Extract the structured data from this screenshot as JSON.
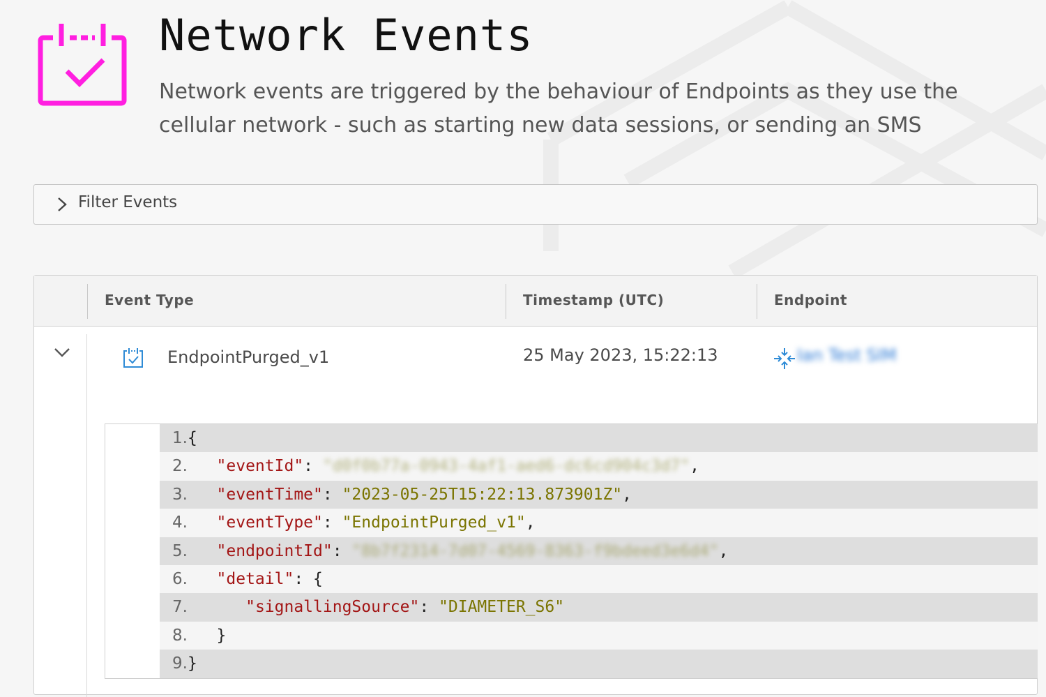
{
  "page": {
    "title": "Network Events",
    "description": "Network events are triggered by the behaviour of Endpoints as they use the cellular network - such as starting new data sessions, or sending an SMS",
    "icon": "calendar-check-icon",
    "accent_color": "#ff1fe0"
  },
  "filter": {
    "label": "Filter Events",
    "icon": "chevron-right-icon"
  },
  "table": {
    "columns": [
      "Event Type",
      "Timestamp (UTC)",
      "Endpoint"
    ],
    "rows": [
      {
        "event_type": "EndpointPurged_v1",
        "timestamp": "25 May 2023, 15:22:13",
        "endpoint": "Ian Test SIM",
        "event_icon": "calendar-check-icon",
        "endpoint_icon": "compress-arrows-icon",
        "expanded": true
      }
    ]
  },
  "code": {
    "lines": [
      {
        "n": "1.",
        "indent": "",
        "key": "",
        "sep": "",
        "value": "",
        "value_class": "",
        "tail": "{"
      },
      {
        "n": "2.",
        "indent": "   ",
        "key": "\"eventId\"",
        "sep": ": ",
        "value": "\"d0f0b77a-0943-4af1-aed6-dc6cd904c3d7\"",
        "value_class": "redacted",
        "tail": ","
      },
      {
        "n": "3.",
        "indent": "   ",
        "key": "\"eventTime\"",
        "sep": ": ",
        "value": "\"2023-05-25T15:22:13.873901Z\"",
        "value_class": "str",
        "tail": ","
      },
      {
        "n": "4.",
        "indent": "   ",
        "key": "\"eventType\"",
        "sep": ": ",
        "value": "\"EndpointPurged_v1\"",
        "value_class": "str",
        "tail": ","
      },
      {
        "n": "5.",
        "indent": "   ",
        "key": "\"endpointId\"",
        "sep": ": ",
        "value": "\"8b7f2314-7d07-4569-8363-f9bdeed3e6d4\"",
        "value_class": "redacted",
        "tail": ","
      },
      {
        "n": "6.",
        "indent": "   ",
        "key": "\"detail\"",
        "sep": ": ",
        "value": "",
        "value_class": "",
        "tail": "{"
      },
      {
        "n": "7.",
        "indent": "      ",
        "key": "\"signallingSource\"",
        "sep": ": ",
        "value": "\"DIAMETER_S6\"",
        "value_class": "str",
        "tail": ""
      },
      {
        "n": "8.",
        "indent": "   ",
        "key": "",
        "sep": "",
        "value": "",
        "value_class": "",
        "tail": "}"
      },
      {
        "n": "9.",
        "indent": "",
        "key": "",
        "sep": "",
        "value": "",
        "value_class": "",
        "tail": "}"
      }
    ]
  }
}
